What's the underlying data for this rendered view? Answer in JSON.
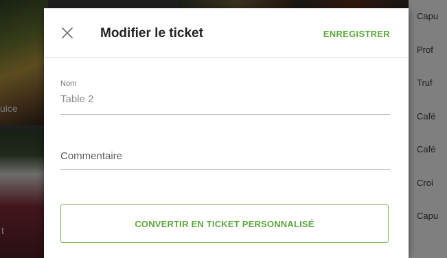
{
  "background": {
    "tiles": [
      {
        "label": "uice"
      },
      {
        "label": "t"
      }
    ],
    "side_list": [
      "Capu",
      "Prof",
      "Truf",
      "Café",
      "Café",
      "Croi",
      "Capu"
    ]
  },
  "dialog": {
    "close_icon": "close-icon",
    "title": "Modifier le ticket",
    "save_label": "ENREGISTRER",
    "name_field": {
      "label": "Nom",
      "value": "Table 2"
    },
    "comment_field": {
      "placeholder": "Commentaire"
    },
    "convert_label": "CONVERTIR EN TICKET PERSONNALISÉ"
  },
  "colors": {
    "accent": "#5aa93a",
    "accent_border": "#74b657"
  }
}
